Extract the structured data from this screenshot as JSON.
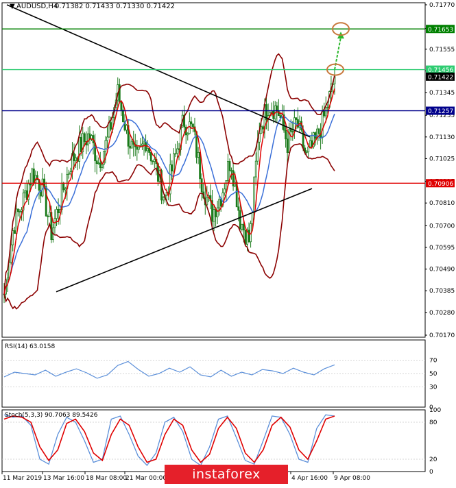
{
  "header": {
    "symbol_label": "AUDUSD,H4",
    "ohlc_text": "0.71382 0.71433 0.71330 0.71422"
  },
  "panels": {
    "rsi": {
      "label": "RSI(14) 63.0158"
    },
    "stoch": {
      "label": "Stoch(5,3,3) 90.7063 89.5426"
    }
  },
  "watermark": {
    "text": "instaforex"
  },
  "colors": {
    "bull_candle": "#1a7a1a",
    "bear_candle": "#1a7a1a",
    "bollinger": "#8b0000",
    "ma_fast": "#e00000",
    "ma_slow": "#3a6fd8",
    "trendline": "#000000",
    "level_green": "#008000",
    "level_light_green": "#2ecc71",
    "level_blue": "#00008b",
    "level_red": "#e00000",
    "projection_arrow": "#2eb82e",
    "target_circle": "#c8783c",
    "rsi_line": "#5b8fd9",
    "stoch_main": "#5b8fd9",
    "stoch_signal": "#e00000"
  },
  "chart_data": [
    {
      "type": "line",
      "title": "AUDUSD,H4",
      "y_axis_ticks": [
        "0.71770",
        "0.71655",
        "0.71555",
        "0.71450",
        "0.71345",
        "0.71235",
        "0.71130",
        "0.71025",
        "0.70915",
        "0.70810",
        "0.70700",
        "0.70595",
        "0.70490",
        "0.70385",
        "0.70280",
        "0.70170"
      ],
      "ylim": [
        0.7016,
        0.7178
      ],
      "x_axis_ticks": [
        "11 Mar 2019",
        "13 Mar 16:00",
        "18 Mar 08:00",
        "21 Mar 00:00",
        "4 Apr 16:00",
        "9 Apr 08:00"
      ],
      "price_path_approx": [
        0.7037,
        0.707,
        0.7082,
        0.7096,
        0.7089,
        0.7067,
        0.7083,
        0.71,
        0.7108,
        0.7114,
        0.7101,
        0.7112,
        0.7135,
        0.7115,
        0.7101,
        0.7112,
        0.7099,
        0.7083,
        0.7101,
        0.7121,
        0.7116,
        0.709,
        0.7076,
        0.7085,
        0.7103,
        0.7073,
        0.7062,
        0.7117,
        0.7129,
        0.7126,
        0.711,
        0.712,
        0.7103,
        0.7111,
        0.7124,
        0.7142
      ],
      "levels": [
        {
          "value": 0.71653,
          "label": "0.71653",
          "color": "#008000"
        },
        {
          "value": 0.71456,
          "label": "0.71456",
          "color": "#2ecc71"
        },
        {
          "value": 0.71422,
          "label": "0.71422",
          "color": "#000000"
        },
        {
          "value": 0.71257,
          "label": "0.71257",
          "color": "#00008b"
        },
        {
          "value": 0.70906,
          "label": "0.70906",
          "color": "#e00000"
        }
      ],
      "annotations": [
        "descending trendline",
        "ascending trendline",
        "projection arrow to 0.71653"
      ]
    },
    {
      "type": "line",
      "title": "RSI(14) 63.0158",
      "ylim": [
        0,
        100
      ],
      "y_axis_ticks": [
        "70",
        "50",
        "30",
        "0"
      ],
      "values_approx": [
        45,
        52,
        50,
        48,
        55,
        46,
        52,
        57,
        51,
        43,
        48,
        62,
        68,
        56,
        46,
        50,
        58,
        52,
        60,
        48,
        45,
        55,
        46,
        52,
        48,
        56,
        54,
        50,
        58,
        52,
        48,
        57,
        63
      ]
    },
    {
      "type": "line",
      "title": "Stoch(5,3,3) 90.7063 89.5426",
      "ylim": [
        0,
        100
      ],
      "y_axis_ticks": [
        "100",
        "80",
        "20",
        "0"
      ],
      "series": [
        {
          "name": "main",
          "values_approx": [
            92,
            88,
            90,
            75,
            20,
            12,
            60,
            88,
            80,
            50,
            15,
            20,
            85,
            90,
            60,
            25,
            10,
            30,
            80,
            88,
            65,
            20,
            10,
            40,
            85,
            90,
            55,
            18,
            12,
            50,
            90,
            88,
            60,
            20,
            15,
            70,
            92,
            90
          ]
        },
        {
          "name": "signal",
          "values_approx": [
            85,
            90,
            88,
            80,
            40,
            18,
            35,
            78,
            85,
            65,
            30,
            18,
            60,
            85,
            75,
            40,
            15,
            20,
            60,
            85,
            75,
            35,
            15,
            28,
            70,
            88,
            70,
            30,
            15,
            35,
            75,
            88,
            72,
            35,
            20,
            50,
            85,
            90
          ]
        }
      ]
    }
  ]
}
